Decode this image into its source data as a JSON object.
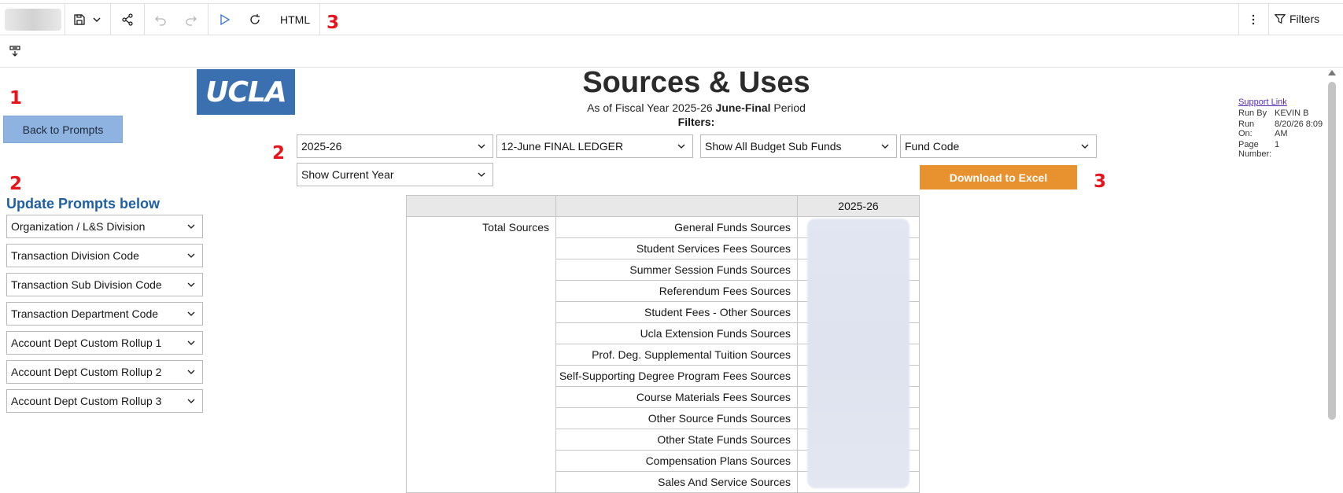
{
  "toolbar": {
    "format_label": "HTML",
    "filters_label": "Filters",
    "annotation": "3"
  },
  "left": {
    "annotation_1": "1",
    "back_label": "Back to Prompts",
    "annotation_2": "2",
    "prompts_title": "Update Prompts below",
    "prompts": [
      "Organization / L&S Division",
      "Transaction Division Code",
      "Transaction Sub Division Code",
      "Transaction Department Code",
      "Account Dept Custom Rollup 1",
      "Account Dept Custom Rollup 2",
      "Account Dept Custom Rollup 3"
    ]
  },
  "header": {
    "logo_text": "UCLA",
    "title": "Sources & Uses",
    "sub_prefix": "As of Fiscal Year 2025-26 ",
    "sub_bold": "June-Final",
    "sub_suffix": " Period",
    "filters_label": "Filters:",
    "annotation_2": "2",
    "annotation_3": "3"
  },
  "filters": {
    "year": "2025-26",
    "ledger": "12-June FINAL LEDGER",
    "budget_sub_funds": "Show All Budget Sub Funds",
    "fund_code": "Fund Code",
    "year_scope": "Show Current Year",
    "download_label": "Download to Excel"
  },
  "runinfo": {
    "support_link": "Support Link",
    "run_by_label": "Run By",
    "run_by": "KEVIN B",
    "run_on_label": "Run On:",
    "run_on": "8/20/26 8:09 AM",
    "page_label": "Page Number:",
    "page": "1"
  },
  "table": {
    "column_header": "2025-26",
    "group_label": "Total Sources",
    "rows": [
      "General Funds Sources",
      "Student Services Fees Sources",
      "Summer Session Funds Sources",
      "Referendum Fees Sources",
      "Student Fees - Other Sources",
      "Ucla Extension Funds Sources",
      "Prof. Deg. Supplemental Tuition Sources",
      "Self-Supporting Degree Program Fees Sources",
      "Course Materials Fees Sources",
      "Other Source Funds Sources",
      "Other State Funds Sources",
      "Compensation Plans Sources",
      "Sales And Service Sources"
    ]
  }
}
